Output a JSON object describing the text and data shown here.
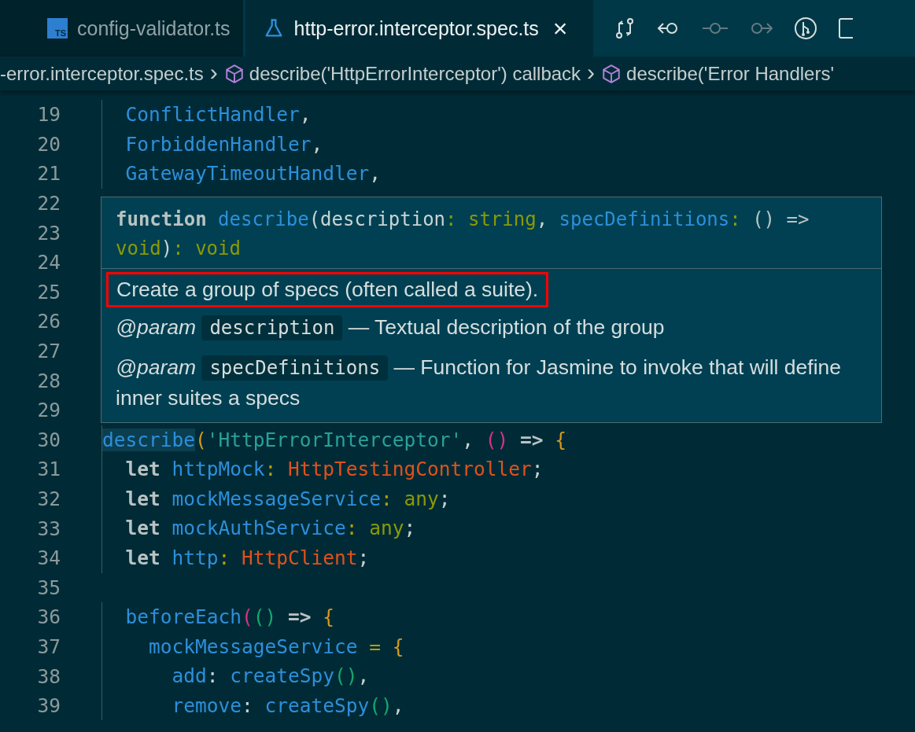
{
  "tabs": [
    {
      "label": "config-validator.ts",
      "kind": "ts",
      "selected": false,
      "icon_text": "TS"
    },
    {
      "label": "http-error.interceptor.spec.ts",
      "kind": "test",
      "selected": true,
      "close": "×"
    }
  ],
  "breadcrumbs": [
    {
      "label": "-error.interceptor.spec.ts",
      "kind": "file"
    },
    {
      "label": "describe('HttpErrorInterceptor') callback",
      "kind": "symbol"
    },
    {
      "label": "describe('Error Handlers'",
      "kind": "symbol"
    }
  ],
  "breadcrumb_separator": "›",
  "lines": [
    {
      "number": "19",
      "tokens": [
        {
          "text": "  ConflictHandler",
          "kind": "fn"
        },
        {
          "text": ",",
          "kind": "p"
        }
      ]
    },
    {
      "number": "20",
      "tokens": [
        {
          "text": "  ForbiddenHandler",
          "kind": "fn"
        },
        {
          "text": ",",
          "kind": "p"
        }
      ]
    },
    {
      "number": "21",
      "tokens": [
        {
          "text": "  GatewayTimeoutHandler",
          "kind": "fn"
        },
        {
          "text": ",",
          "kind": "p"
        }
      ]
    },
    {
      "number": "22"
    },
    {
      "number": "23"
    },
    {
      "number": "24"
    },
    {
      "number": "25"
    },
    {
      "number": "26"
    },
    {
      "number": "27"
    },
    {
      "number": "28"
    },
    {
      "number": "29"
    },
    {
      "number": "30",
      "tokens": [
        {
          "text": "describe",
          "kind": "fnhl"
        },
        {
          "text": "(",
          "kind": "b1"
        },
        {
          "text": "'HttpErrorInterceptor'",
          "kind": "str"
        },
        {
          "text": ",",
          "kind": "p"
        },
        {
          "text": " ()",
          "kind": "b2"
        },
        {
          "text": " =>",
          "kind": "kw"
        },
        {
          "text": " {",
          "kind": "b1"
        }
      ]
    },
    {
      "number": "31",
      "tokens": [
        {
          "text": "  let",
          "kind": "kw"
        },
        {
          "text": " httpMock",
          "kind": "fn"
        },
        {
          "text": ":",
          "kind": "op"
        },
        {
          "text": " HttpTestingController",
          "kind": "type"
        },
        {
          "text": ";",
          "kind": "p"
        }
      ]
    },
    {
      "number": "32",
      "tokens": [
        {
          "text": "  let",
          "kind": "kw"
        },
        {
          "text": " mockMessageService",
          "kind": "fn"
        },
        {
          "text": ":",
          "kind": "op"
        },
        {
          "text": " any",
          "kind": "any"
        },
        {
          "text": ";",
          "kind": "p"
        }
      ]
    },
    {
      "number": "33",
      "tokens": [
        {
          "text": "  let",
          "kind": "kw"
        },
        {
          "text": " mockAuthService",
          "kind": "fn"
        },
        {
          "text": ":",
          "kind": "op"
        },
        {
          "text": " any",
          "kind": "any"
        },
        {
          "text": ";",
          "kind": "p"
        }
      ]
    },
    {
      "number": "34",
      "tokens": [
        {
          "text": "  let",
          "kind": "kw"
        },
        {
          "text": " http",
          "kind": "fn"
        },
        {
          "text": ":",
          "kind": "op"
        },
        {
          "text": " HttpClient",
          "kind": "type"
        },
        {
          "text": ";",
          "kind": "p"
        }
      ]
    },
    {
      "number": "35"
    },
    {
      "number": "36",
      "tokens": [
        {
          "text": "  beforeEach",
          "kind": "fn"
        },
        {
          "text": "(",
          "kind": "b2"
        },
        {
          "text": "()",
          "kind": "b3"
        },
        {
          "text": " =>",
          "kind": "kw"
        },
        {
          "text": " {",
          "kind": "b1"
        }
      ]
    },
    {
      "number": "37",
      "tokens": [
        {
          "text": "    mockMessageService",
          "kind": "fn"
        },
        {
          "text": " =",
          "kind": "op"
        },
        {
          "text": " {",
          "kind": "b1"
        }
      ]
    },
    {
      "number": "38",
      "tokens": [
        {
          "text": "      add",
          "kind": "fn"
        },
        {
          "text": ":",
          "kind": "p"
        },
        {
          "text": " createSpy",
          "kind": "fn"
        },
        {
          "text": "()",
          "kind": "b3"
        },
        {
          "text": ",",
          "kind": "p"
        }
      ]
    },
    {
      "number": "39",
      "tokens": [
        {
          "text": "      remove",
          "kind": "fn"
        },
        {
          "text": ":",
          "kind": "p"
        },
        {
          "text": " createSpy",
          "kind": "fn"
        },
        {
          "text": "()",
          "kind": "b3"
        },
        {
          "text": ",",
          "kind": "p"
        }
      ]
    }
  ],
  "hover": {
    "signature": [
      {
        "text": "function",
        "kind": "kw"
      },
      {
        "text": " describe",
        "kind": "fn"
      },
      {
        "text": "(description",
        "kind": "p"
      },
      {
        "text": ": string",
        "kind": "any"
      },
      {
        "text": ",",
        "kind": "p"
      },
      {
        "text": " specDefinitions",
        "kind": "fn"
      },
      {
        "text": ":",
        "kind": "any"
      },
      {
        "text": " () =>",
        "kind": "kw"
      },
      {
        "text": " void",
        "kind": "any"
      },
      {
        "text": ")",
        "kind": "p"
      },
      {
        "text": ": void",
        "kind": "any"
      }
    ],
    "summary": "Create a group of specs (often called a suite).",
    "summary_highlighted": true,
    "params": [
      {
        "tag": "@param",
        "name": "description",
        "text": "— Textual description of the group"
      },
      {
        "tag": "@param",
        "name": "specDefinitions",
        "text": "— Function for Jasmine to invoke that will define inner suites a specs"
      }
    ]
  }
}
